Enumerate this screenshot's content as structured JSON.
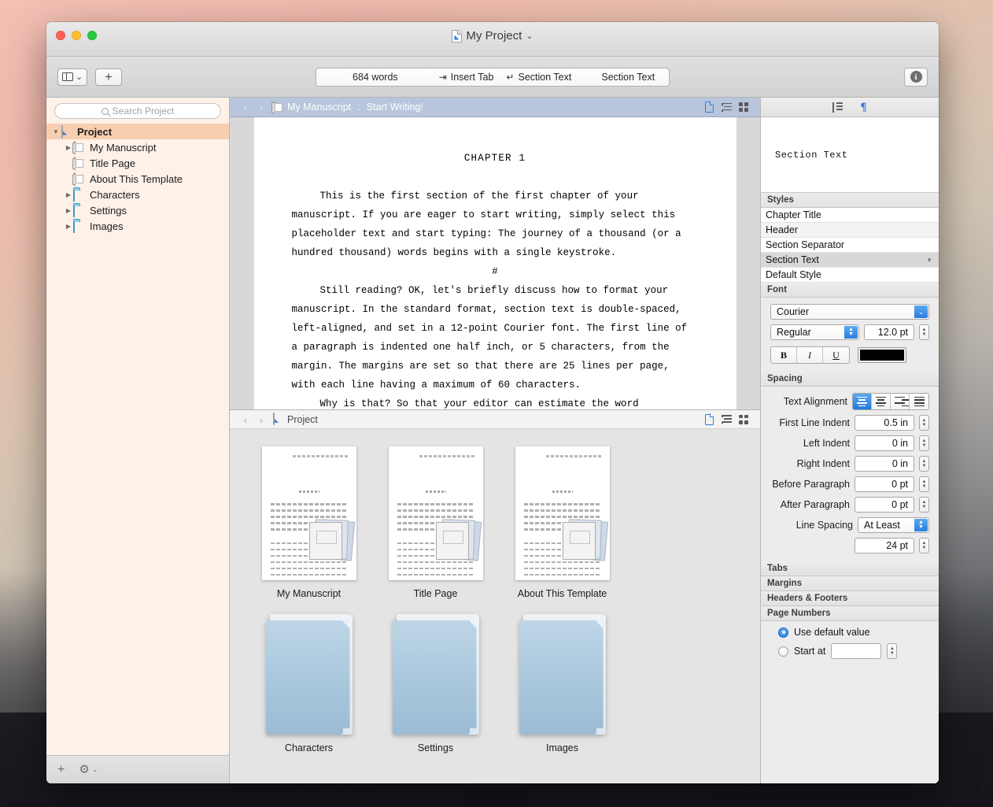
{
  "window": {
    "title": "My Project",
    "title_chevron": "⌄"
  },
  "toolbar": {
    "view_layout_label": "view-layout",
    "add_label": "+",
    "word_count": "684 words",
    "insert_tab": "Insert Tab",
    "tab_arrow": "⇥",
    "return_arrow": "↵",
    "section_text_left": "Section Text",
    "section_text_right": "Section Text",
    "info_label": "i"
  },
  "binder": {
    "search_placeholder": "Search Project",
    "items": [
      {
        "label": "Project",
        "icon": "project-icon",
        "indent": 0,
        "disclosure": "open",
        "selected": true
      },
      {
        "label": "My Manuscript",
        "icon": "document-stack-icon",
        "indent": 1,
        "disclosure": "closed",
        "selected": false
      },
      {
        "label": "Title Page",
        "icon": "document-stack-icon",
        "indent": 1,
        "disclosure": "none",
        "selected": false
      },
      {
        "label": "About This Template",
        "icon": "document-stack-icon",
        "indent": 1,
        "disclosure": "none",
        "selected": false
      },
      {
        "label": "Characters",
        "icon": "folder-icon",
        "indent": 1,
        "disclosure": "closed",
        "selected": false
      },
      {
        "label": "Settings",
        "icon": "folder-icon",
        "indent": 1,
        "disclosure": "closed",
        "selected": false
      },
      {
        "label": "Images",
        "icon": "folder-icon",
        "indent": 1,
        "disclosure": "closed",
        "selected": false
      }
    ],
    "footer": {
      "add": "+",
      "gear": "⚙",
      "gear_chevron": "⌄"
    }
  },
  "editor_header": {
    "back": "‹",
    "forward": "›",
    "doc_title": "My Manuscript",
    "separator": ":",
    "subtitle": "Start Writing!"
  },
  "document": {
    "chapter": "CHAPTER 1",
    "paragraphs": [
      "This is the first section of the first chapter of your manuscript. If you are eager to start writing, simply select this placeholder text and start typing: The journey of a thousand (or a hundred thousand) words begins with a single keystroke."
    ],
    "separator": "#",
    "paragraphs2": [
      "Still reading? OK, let's briefly discuss how to format your manuscript. In the standard format, section text is double-spaced, left-aligned, and set in a 12-point Courier font. The first line of a paragraph is indented one half inch, or 5 characters, from the margin. The margins are set so that there are 25 lines per page, with each line having a maximum of 60 characters.",
      "Why is that? So that your editor can estimate the word"
    ]
  },
  "browser_header": {
    "back": "‹",
    "forward": "›",
    "title": "Project"
  },
  "browser_items": [
    {
      "label": "My Manuscript",
      "type": "document"
    },
    {
      "label": "Title Page",
      "type": "document"
    },
    {
      "label": "About This Template",
      "type": "document"
    },
    {
      "label": "Characters",
      "type": "folder"
    },
    {
      "label": "Settings",
      "type": "folder"
    },
    {
      "label": "Images",
      "type": "folder"
    }
  ],
  "inspector": {
    "preview_text": "Section Text",
    "styles_header": "Styles",
    "styles": [
      {
        "label": "Chapter Title",
        "selected": false
      },
      {
        "label": "Header",
        "selected": false
      },
      {
        "label": "Section Separator",
        "selected": false
      },
      {
        "label": "Section Text",
        "selected": true
      },
      {
        "label": "Default Style",
        "selected": false
      }
    ],
    "font_header": "Font",
    "font_family": "Courier",
    "font_style": "Regular",
    "font_size": "12.0 pt",
    "bold": "B",
    "italic": "I",
    "underline": "U",
    "font_color": "#000000",
    "spacing_header": "Spacing",
    "text_alignment_label": "Text Alignment",
    "alignment_selected": "left",
    "first_line_indent_label": "First Line Indent",
    "first_line_indent": "0.5 in",
    "left_indent_label": "Left Indent",
    "left_indent": "0 in",
    "right_indent_label": "Right Indent",
    "right_indent": "0 in",
    "before_paragraph_label": "Before Paragraph",
    "before_paragraph": "0 pt",
    "after_paragraph_label": "After Paragraph",
    "after_paragraph": "0 pt",
    "line_spacing_label": "Line Spacing",
    "line_spacing": "At Least",
    "line_spacing_value": "24 pt",
    "tabs_header": "Tabs",
    "margins_header": "Margins",
    "headers_footers_header": "Headers & Footers",
    "page_numbers_header": "Page Numbers",
    "use_default_label": "Use default value",
    "start_at_label": "Start at",
    "start_at_value": "",
    "page_number_mode": "default"
  },
  "colors": {
    "accent_blue": "#2f7ddb",
    "binder_bg": "#fdf1e8",
    "binder_selected": "#f7cfb0",
    "editor_header_active": "#b8c5dc"
  }
}
